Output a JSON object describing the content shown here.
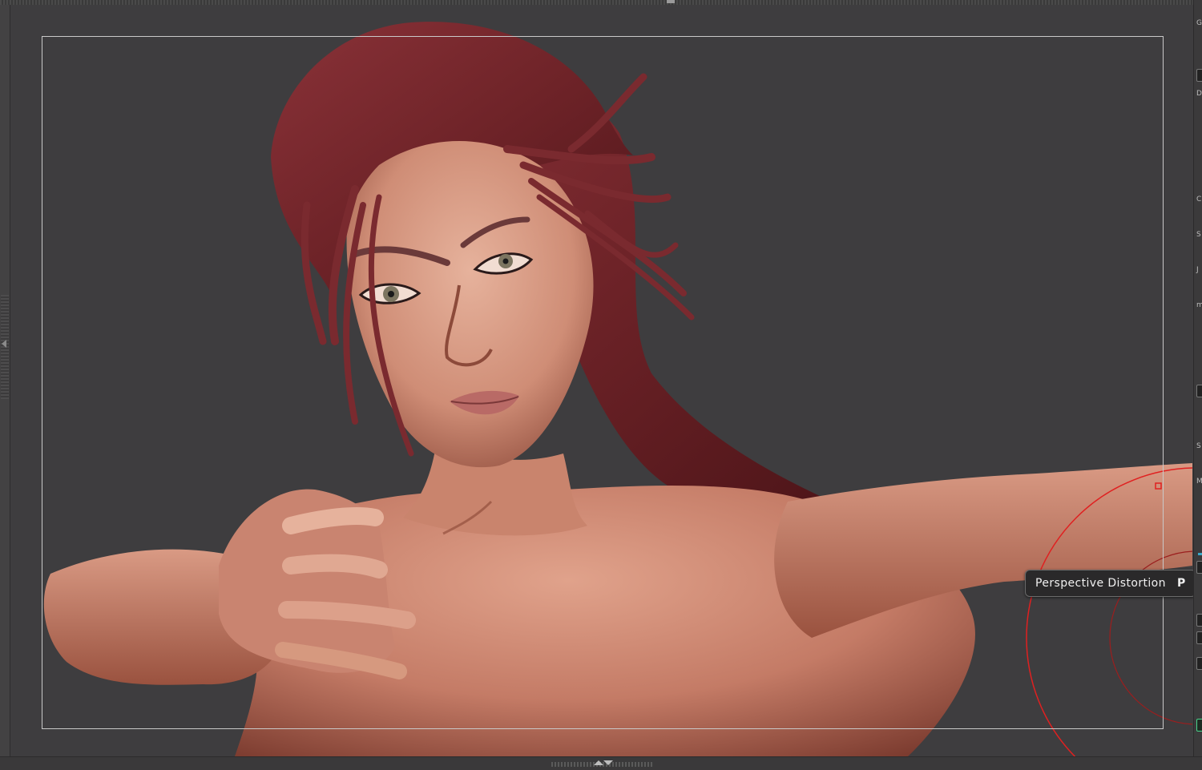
{
  "viewport": {
    "tooltip": {
      "label": "Perspective Distortion",
      "shortcut": "P"
    },
    "model": "sculpted female bust with red hair"
  },
  "right_tray": {
    "letters": [
      "G",
      "D",
      "C",
      "S",
      "J",
      "m",
      "S",
      "M"
    ]
  },
  "colors": {
    "background": "#3e3d3f",
    "hair": "#7a2a2f",
    "skin": "#c67f6a",
    "brush_circle": "#e02020",
    "frame": "#c9c9c9"
  }
}
